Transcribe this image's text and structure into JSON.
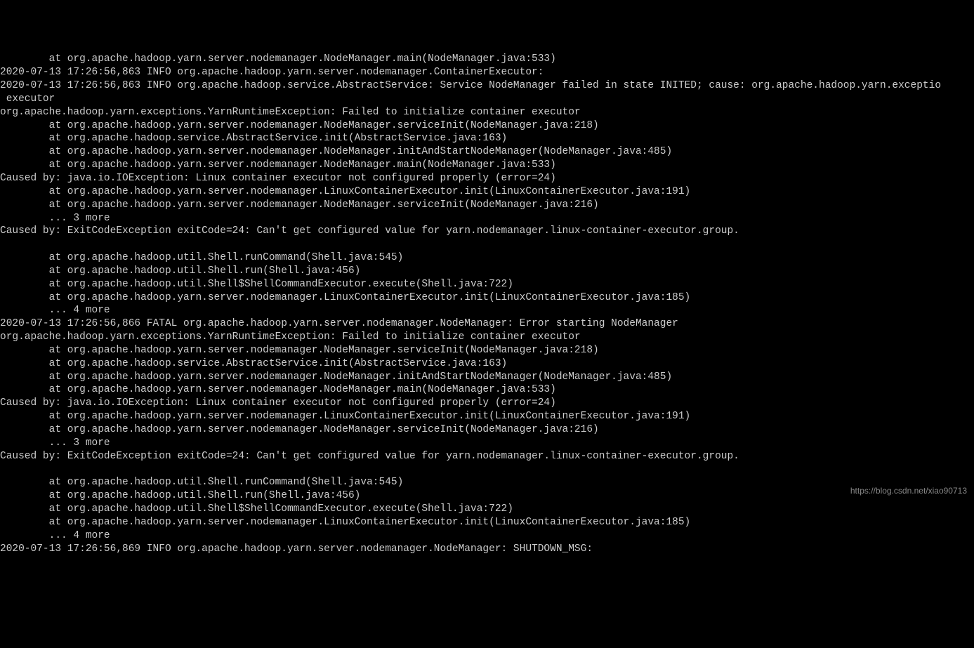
{
  "watermark": "https://blog.csdn.net/xiao90713",
  "log_lines": [
    "        at org.apache.hadoop.yarn.server.nodemanager.NodeManager.main(NodeManager.java:533)",
    "2020-07-13 17:26:56,863 INFO org.apache.hadoop.yarn.server.nodemanager.ContainerExecutor:",
    "2020-07-13 17:26:56,863 INFO org.apache.hadoop.service.AbstractService: Service NodeManager failed in state INITED; cause: org.apache.hadoop.yarn.exceptio",
    " executor",
    "org.apache.hadoop.yarn.exceptions.YarnRuntimeException: Failed to initialize container executor",
    "        at org.apache.hadoop.yarn.server.nodemanager.NodeManager.serviceInit(NodeManager.java:218)",
    "        at org.apache.hadoop.service.AbstractService.init(AbstractService.java:163)",
    "        at org.apache.hadoop.yarn.server.nodemanager.NodeManager.initAndStartNodeManager(NodeManager.java:485)",
    "        at org.apache.hadoop.yarn.server.nodemanager.NodeManager.main(NodeManager.java:533)",
    "Caused by: java.io.IOException: Linux container executor not configured properly (error=24)",
    "        at org.apache.hadoop.yarn.server.nodemanager.LinuxContainerExecutor.init(LinuxContainerExecutor.java:191)",
    "        at org.apache.hadoop.yarn.server.nodemanager.NodeManager.serviceInit(NodeManager.java:216)",
    "        ... 3 more",
    "Caused by: ExitCodeException exitCode=24: Can't get configured value for yarn.nodemanager.linux-container-executor.group.",
    "",
    "        at org.apache.hadoop.util.Shell.runCommand(Shell.java:545)",
    "        at org.apache.hadoop.util.Shell.run(Shell.java:456)",
    "        at org.apache.hadoop.util.Shell$ShellCommandExecutor.execute(Shell.java:722)",
    "        at org.apache.hadoop.yarn.server.nodemanager.LinuxContainerExecutor.init(LinuxContainerExecutor.java:185)",
    "        ... 4 more",
    "2020-07-13 17:26:56,866 FATAL org.apache.hadoop.yarn.server.nodemanager.NodeManager: Error starting NodeManager",
    "org.apache.hadoop.yarn.exceptions.YarnRuntimeException: Failed to initialize container executor",
    "        at org.apache.hadoop.yarn.server.nodemanager.NodeManager.serviceInit(NodeManager.java:218)",
    "        at org.apache.hadoop.service.AbstractService.init(AbstractService.java:163)",
    "        at org.apache.hadoop.yarn.server.nodemanager.NodeManager.initAndStartNodeManager(NodeManager.java:485)",
    "        at org.apache.hadoop.yarn.server.nodemanager.NodeManager.main(NodeManager.java:533)",
    "Caused by: java.io.IOException: Linux container executor not configured properly (error=24)",
    "        at org.apache.hadoop.yarn.server.nodemanager.LinuxContainerExecutor.init(LinuxContainerExecutor.java:191)",
    "        at org.apache.hadoop.yarn.server.nodemanager.NodeManager.serviceInit(NodeManager.java:216)",
    "        ... 3 more",
    "Caused by: ExitCodeException exitCode=24: Can't get configured value for yarn.nodemanager.linux-container-executor.group.",
    "",
    "        at org.apache.hadoop.util.Shell.runCommand(Shell.java:545)",
    "        at org.apache.hadoop.util.Shell.run(Shell.java:456)",
    "        at org.apache.hadoop.util.Shell$ShellCommandExecutor.execute(Shell.java:722)",
    "        at org.apache.hadoop.yarn.server.nodemanager.LinuxContainerExecutor.init(LinuxContainerExecutor.java:185)",
    "        ... 4 more",
    "2020-07-13 17:26:56,869 INFO org.apache.hadoop.yarn.server.nodemanager.NodeManager: SHUTDOWN_MSG:"
  ]
}
